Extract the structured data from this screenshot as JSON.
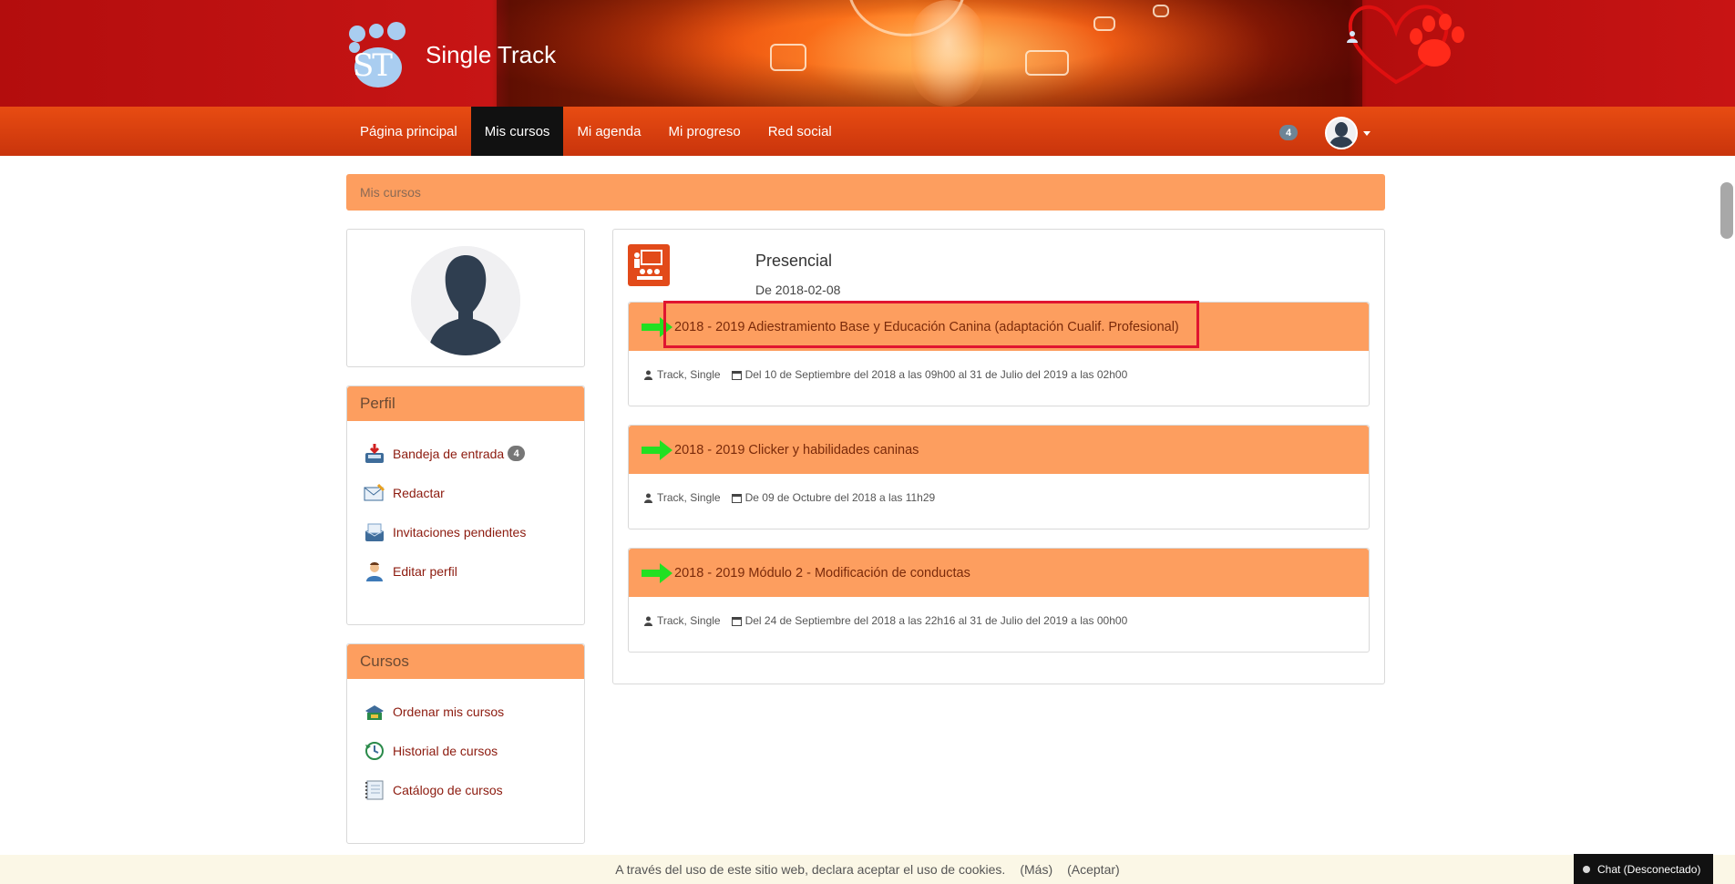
{
  "brand": {
    "name": "Single Track",
    "initials": "ST"
  },
  "nav": {
    "items": [
      {
        "label": "Página principal",
        "active": false
      },
      {
        "label": "Mis cursos",
        "active": true
      },
      {
        "label": "Mi agenda",
        "active": false
      },
      {
        "label": "Mi progreso",
        "active": false
      },
      {
        "label": "Red social",
        "active": false
      }
    ],
    "notification_count": "4"
  },
  "breadcrumb": "Mis cursos",
  "profile_menu": {
    "title": "Perfil",
    "items": [
      {
        "label": "Bandeja de entrada",
        "badge": "4",
        "icon": "inbox-icon"
      },
      {
        "label": "Redactar",
        "icon": "compose-icon"
      },
      {
        "label": "Invitaciones pendientes",
        "icon": "invitations-icon"
      },
      {
        "label": "Editar perfil",
        "icon": "edit-profile-icon"
      }
    ]
  },
  "courses_menu": {
    "title": "Cursos",
    "items": [
      {
        "label": "Ordenar mis cursos",
        "icon": "sort-courses-icon"
      },
      {
        "label": "Historial de cursos",
        "icon": "history-icon"
      },
      {
        "label": "Catálogo de cursos",
        "icon": "catalog-icon"
      }
    ]
  },
  "category": {
    "title": "Presencial",
    "date": "De 2018-02-08"
  },
  "courses": [
    {
      "title": "2018 - 2019 Adiestramiento Base y Educación Canina (adaptación Cualif. Profesional)",
      "teacher": "Track, Single",
      "dates": "Del 10 de Septiembre del 2018 a las 09h00 al 31 de Julio del 2019 a las 02h00"
    },
    {
      "title": "2018 - 2019 Clicker y habilidades caninas",
      "teacher": "Track, Single",
      "dates": "De 09 de Octubre del 2018 a las 11h29"
    },
    {
      "title": "2018 - 2019 Módulo 2 - Modificación de conductas",
      "teacher": "Track, Single",
      "dates": "Del 24 de Septiembre del 2018 a las 22h16 al 31 de Julio del 2019 a las 00h00"
    }
  ],
  "cookie_bar": {
    "text": "A través del uso de este sitio web, declara aceptar el uso de cookies.",
    "more": "(Más)",
    "accept": "(Aceptar)"
  },
  "chat": {
    "label": "Chat (Desconectado)"
  },
  "colors": {
    "header_red": "#c71515",
    "navbar_orange": "#e84c12",
    "panel_orange": "#fd9e5f",
    "link_red": "#8c1a0e",
    "highlight_red": "#e01530",
    "arrow_green": "#22e022"
  }
}
